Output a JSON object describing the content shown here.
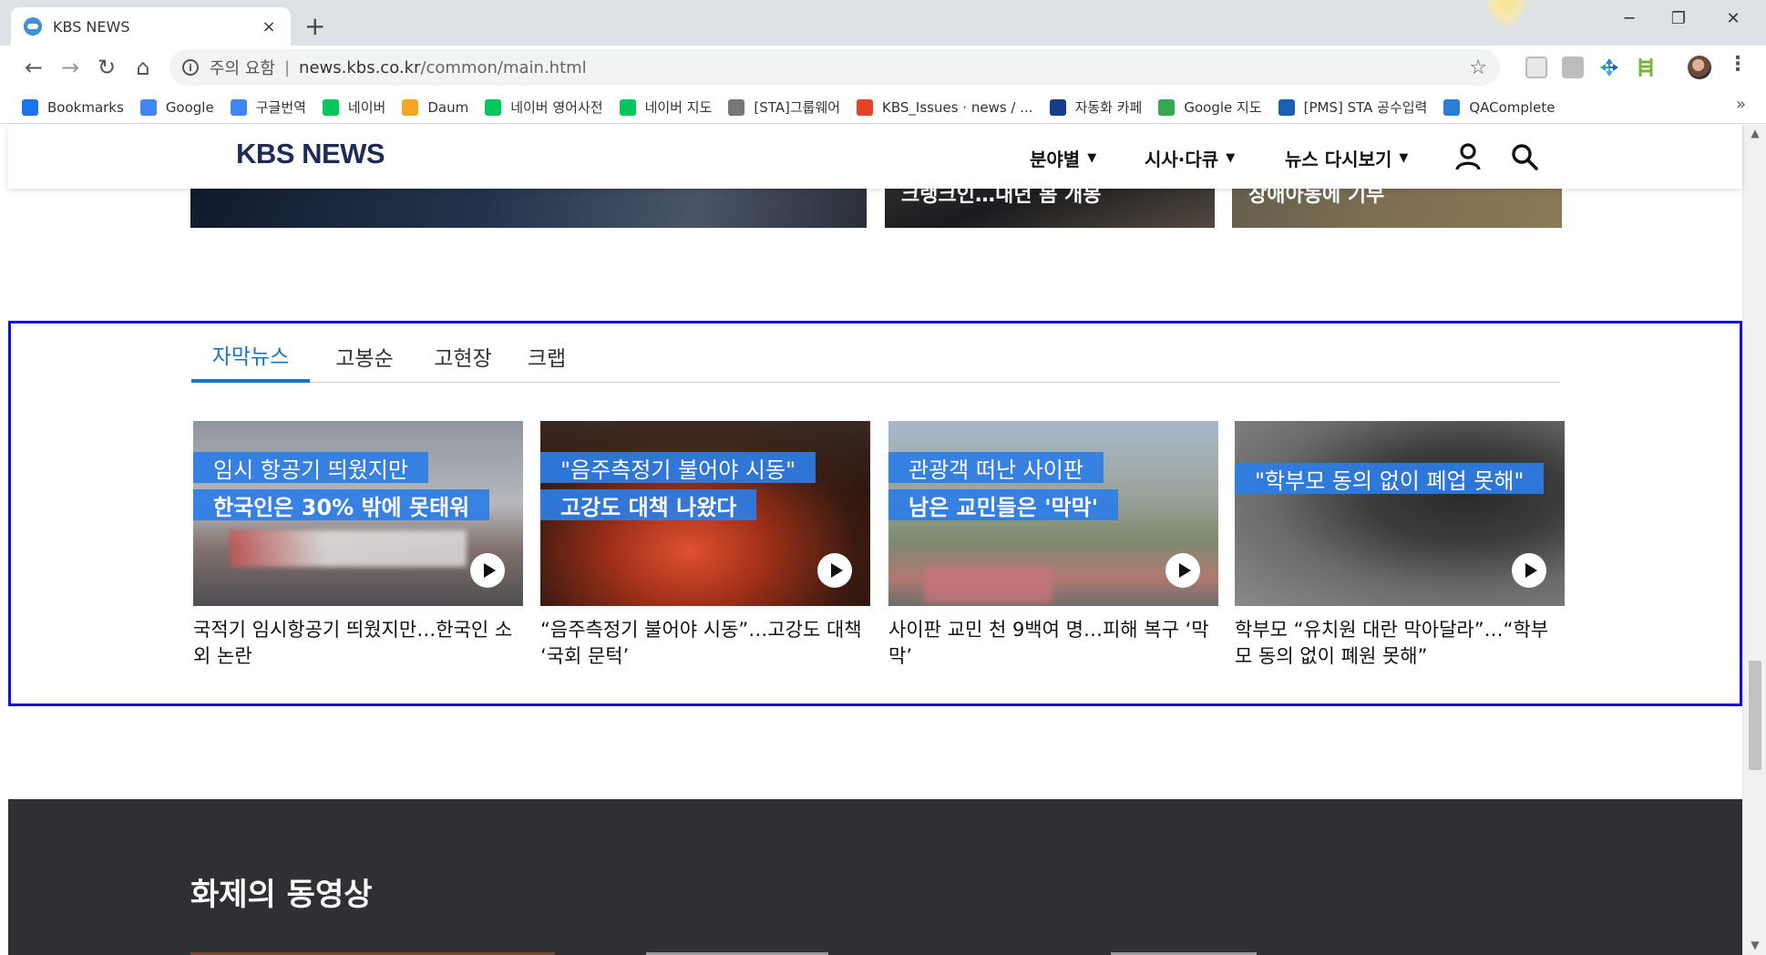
{
  "browser": {
    "tab_title": "KBS NEWS",
    "tab_close": "×",
    "new_tab": "+",
    "window_controls": {
      "minimize": "─",
      "restore": "❐",
      "close": "✕"
    },
    "nav": {
      "back": "←",
      "forward": "→",
      "reload": "↻",
      "home": "⌂"
    },
    "security_label": "주의 요함",
    "url_host": "news.kbs.co.kr",
    "url_path": "/common/main.html",
    "bookmark_star": "☆",
    "menu": "⋮",
    "bookmarks": [
      {
        "label": "Bookmarks",
        "icon": "star-icon",
        "color": "#1a73e8"
      },
      {
        "label": "Google",
        "icon": "google-icon",
        "color": "#4285f4"
      },
      {
        "label": "구글번역",
        "icon": "translate-icon",
        "color": "#4285f4"
      },
      {
        "label": "네이버",
        "icon": "naver-icon",
        "color": "#03c75a"
      },
      {
        "label": "Daum",
        "icon": "daum-icon",
        "color": "#f5a623"
      },
      {
        "label": "네이버 영어사전",
        "icon": "dictionary-icon",
        "color": "#03c75a"
      },
      {
        "label": "네이버 지도",
        "icon": "naver-icon",
        "color": "#03c75a"
      },
      {
        "label": "[STA]그룹웨어",
        "icon": "page-icon",
        "color": "#777777"
      },
      {
        "label": "KBS_Issues · news / ...",
        "icon": "gitlab-icon",
        "color": "#e24329"
      },
      {
        "label": "자동화 카페",
        "icon": "std-icon",
        "color": "#1a3a8a"
      },
      {
        "label": "Google 지도",
        "icon": "maps-icon",
        "color": "#34a853"
      },
      {
        "label": "[PMS] STA 공수입력",
        "icon": "pms-icon",
        "color": "#1a5fb4"
      },
      {
        "label": "QAComplete",
        "icon": "qacomplete-icon",
        "color": "#2a7fd4"
      }
    ],
    "bookmarks_more": "»"
  },
  "site": {
    "logo": "KBS NEWS",
    "gnb": [
      {
        "label": "분야별",
        "caret": "▼"
      },
      {
        "label": "시사·다큐",
        "caret": "▼"
      },
      {
        "label": "뉴스 다시보기",
        "caret": "▼"
      }
    ],
    "top_cards": [
      {
        "text": ""
      },
      {
        "text": "크랭크인…내년 봄 개봉"
      },
      {
        "text": "장애아동에 기부"
      }
    ]
  },
  "section": {
    "tabs": [
      "자막뉴스",
      "고봉순",
      "고현장",
      "크랩"
    ],
    "active_tab": 0,
    "cards": [
      {
        "caption1": "임시 항공기 띄웠지만",
        "caption2": "한국인은 30% 밖에 못태워",
        "headline": "국적기 임시항공기 띄웠지만…한국인 소외 논란"
      },
      {
        "caption1": "\"음주측정기 불어야 시동\"",
        "caption2": "고강도 대책 나왔다",
        "headline": "“음주측정기 불어야 시동”…고강도 대책 ‘국회 문턱’"
      },
      {
        "caption1": "관광객 떠난 사이판",
        "caption2": "남은 교민들은 '막막'",
        "headline": "사이판 교민 천 9백여 명…피해 복구 ‘막막’"
      },
      {
        "caption1": "\"학부모 동의 없이 폐업 못해\"",
        "caption2": "",
        "headline": "학부모 “유치원 대란 막아달라”…“학부모 동의 없이 폐원 못해”"
      }
    ]
  },
  "dark_section": {
    "title": "화제의 동영상"
  },
  "colors": {
    "accent": "#1a73c6",
    "logo": "#1c2b57",
    "focus_border": "#1212e0",
    "dark_bg": "#2f3033"
  }
}
